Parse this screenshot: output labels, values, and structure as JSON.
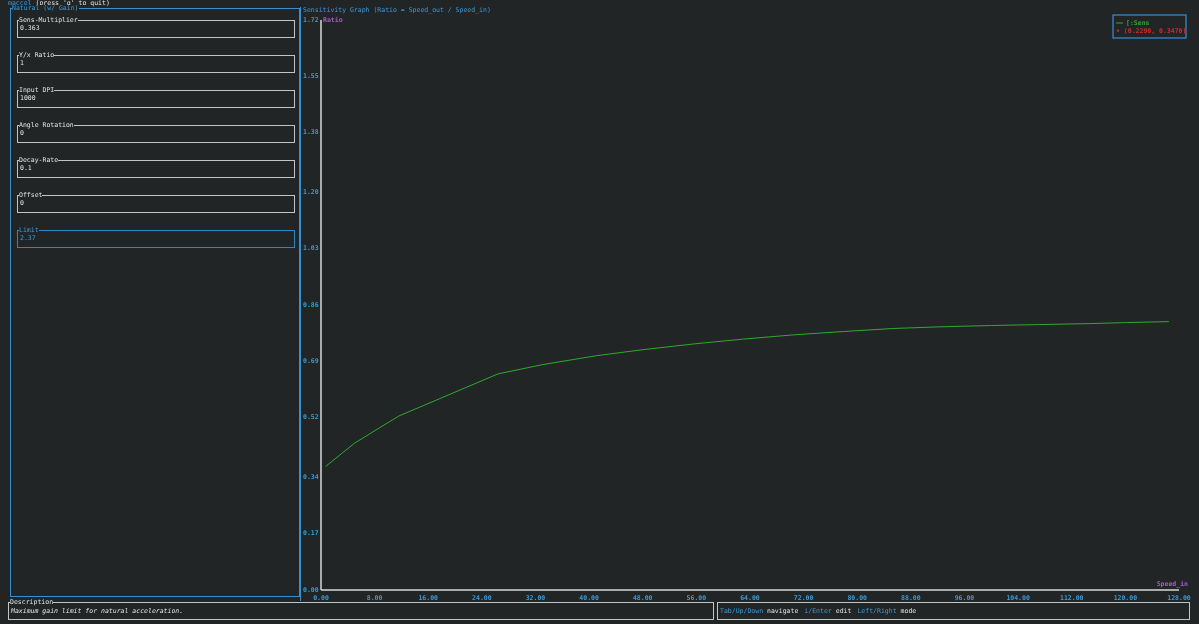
{
  "header": {
    "app_name": "maccel",
    "hint": "(press 'q' to quit)"
  },
  "mode_panel": {
    "title": "Natural (w/ Gain)",
    "fields": [
      {
        "label": "Sens-Multiplier",
        "value": "0.363",
        "selected": false
      },
      {
        "label": "Y/x Ratio",
        "value": "1",
        "selected": false
      },
      {
        "label": "Input DPI",
        "value": "1000",
        "selected": false
      },
      {
        "label": "Angle Rotation",
        "value": "0",
        "selected": false
      },
      {
        "label": "Decay-Rate",
        "value": "0.1",
        "selected": false
      },
      {
        "label": "Offset",
        "value": "0",
        "selected": false
      },
      {
        "label": "Limit",
        "value": "2.37",
        "selected": true
      }
    ]
  },
  "graph": {
    "title": "Sensitivity Graph (Ratio = Speed_out / Speed_in)",
    "current_point": "• (0.2290, 0.3470)",
    "chart_data": {
      "type": "line",
      "xlabel": "Speed_in",
      "ylabel": "Ratio",
      "x": [
        0.7,
        5,
        11.6,
        18,
        26.4,
        33,
        41.1,
        48,
        55.8,
        63,
        70.6,
        78,
        85.3,
        92,
        100,
        107,
        114.7,
        120,
        126.5
      ],
      "series": [
        {
          "name": "[:Sens",
          "color": "#2fa82f",
          "values": [
            0.373,
            0.443,
            0.525,
            0.58,
            0.652,
            0.68,
            0.707,
            0.725,
            0.743,
            0.757,
            0.77,
            0.78,
            0.789,
            0.794,
            0.798,
            0.801,
            0.804,
            0.807,
            0.81
          ]
        }
      ],
      "xlim": [
        0,
        128
      ],
      "ylim": [
        0,
        1.72
      ],
      "xticks": [
        {
          "value": 0,
          "label": "0.00"
        },
        {
          "value": 8,
          "label": "8.00"
        },
        {
          "value": 16,
          "label": "16.00"
        },
        {
          "value": 24,
          "label": "24.00"
        },
        {
          "value": 32,
          "label": "32.00"
        },
        {
          "value": 40,
          "label": "40.00"
        },
        {
          "value": 48,
          "label": "48.00"
        },
        {
          "value": 56,
          "label": "56.00"
        },
        {
          "value": 64,
          "label": "64.00"
        },
        {
          "value": 72,
          "label": "72.00"
        },
        {
          "value": 80,
          "label": "80.00"
        },
        {
          "value": 88,
          "label": "88.00"
        },
        {
          "value": 96,
          "label": "96.00"
        },
        {
          "value": 104,
          "label": "104.00"
        },
        {
          "value": 112,
          "label": "112.00"
        },
        {
          "value": 120,
          "label": "120.00"
        },
        {
          "value": 128,
          "label": "128.00"
        }
      ],
      "yticks": [
        {
          "value": 0,
          "label": "0.00"
        },
        {
          "value": 0.17,
          "label": "0.17"
        },
        {
          "value": 0.34,
          "label": "0.34"
        },
        {
          "value": 0.52,
          "label": "0.52"
        },
        {
          "value": 0.69,
          "label": "0.69"
        },
        {
          "value": 0.86,
          "label": "0.86"
        },
        {
          "value": 1.03,
          "label": "1.03"
        },
        {
          "value": 1.2,
          "label": "1.20"
        },
        {
          "value": 1.38,
          "label": "1.38"
        },
        {
          "value": 1.55,
          "label": "1.55"
        },
        {
          "value": 1.72,
          "label": "1.72"
        }
      ]
    }
  },
  "description": {
    "title": "Description",
    "text": "Maximum gain limit for natural acceleration."
  },
  "help": [
    {
      "key": "Tab/Up/Down",
      "action": "navigate"
    },
    {
      "key": "i/Enter",
      "action": "edit"
    },
    {
      "key": "Left/Right",
      "action": "mode"
    }
  ]
}
